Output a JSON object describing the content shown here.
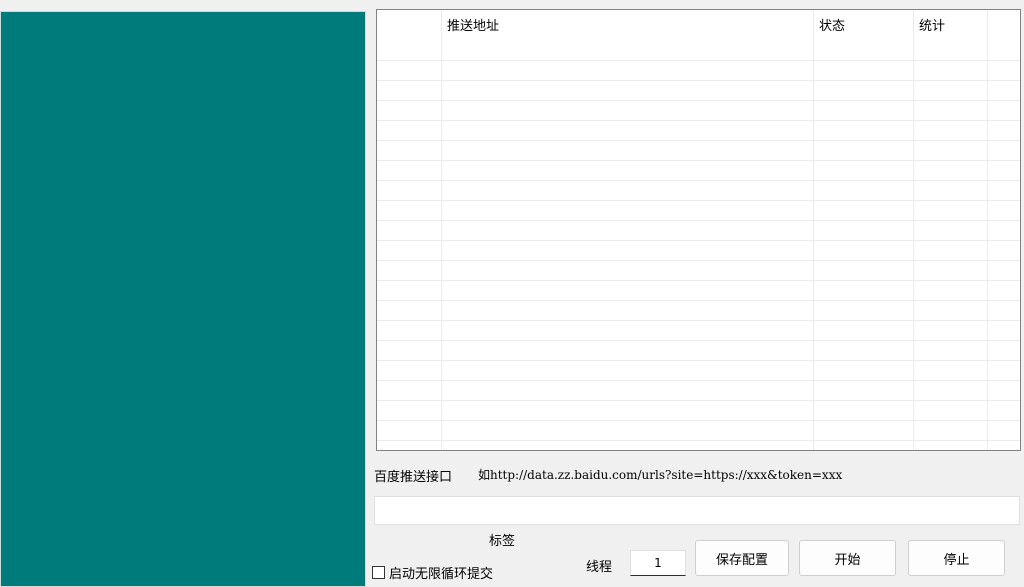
{
  "table": {
    "columns": [
      "",
      "推送地址",
      "状态",
      "统计"
    ],
    "rows": []
  },
  "api": {
    "label": "百度推送接口",
    "hint": "如http://data.zz.baidu.com/urls?site=https://xxx&token=xxx",
    "value": ""
  },
  "controls": {
    "tag_label": "标签",
    "loop_label": "启动无限循环提交",
    "loop_checked": false,
    "thread_label": "线程",
    "thread_value": "1",
    "save_label": "保存配置",
    "start_label": "开始",
    "stop_label": "停止"
  },
  "colors": {
    "left_panel": "#007b7b"
  }
}
